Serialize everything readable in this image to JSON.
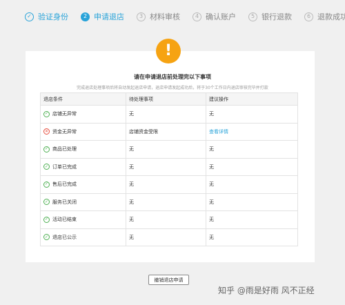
{
  "steps": [
    {
      "num": "✓",
      "label": "验证身份",
      "state": "done"
    },
    {
      "num": "2",
      "label": "申请退店",
      "state": "active"
    },
    {
      "num": "3",
      "label": "材料审核",
      "state": "todo"
    },
    {
      "num": "4",
      "label": "确认账户",
      "state": "todo"
    },
    {
      "num": "5",
      "label": "银行退款",
      "state": "todo"
    },
    {
      "num": "6",
      "label": "退款成功",
      "state": "todo"
    }
  ],
  "notice": {
    "icon": "!",
    "title": "请在申请退店前处理完以下事项",
    "subtitle": "完成退店处理事项后将自动发起退店申请，退店申请发起成功后，将于30个工作日内退店审核完毕并打款"
  },
  "table": {
    "headers": [
      "退店条件",
      "待处理事项",
      "建议操作"
    ],
    "rows": [
      {
        "status": "ok",
        "condition": "店铺无异常",
        "pending": "无",
        "action": "无"
      },
      {
        "status": "bad",
        "condition": "资金无异常",
        "pending": "店铺资金受限",
        "action": "查看详情"
      },
      {
        "status": "ok",
        "condition": "商品已处理",
        "pending": "无",
        "action": "无"
      },
      {
        "status": "ok",
        "condition": "订单已完成",
        "pending": "无",
        "action": "无"
      },
      {
        "status": "ok",
        "condition": "售后已完成",
        "pending": "无",
        "action": "无"
      },
      {
        "status": "ok",
        "condition": "服务已关闭",
        "pending": "无",
        "action": "无"
      },
      {
        "status": "ok",
        "condition": "活动已结束",
        "pending": "无",
        "action": "无"
      },
      {
        "status": "ok",
        "condition": "退店已公示",
        "pending": "无",
        "action": "无"
      }
    ]
  },
  "cancel_button": "撤销退店申请",
  "watermark": "知乎 @雨是好雨 风不正经",
  "colors": {
    "accent": "#29a3d9",
    "warning": "#f6a312",
    "ok": "#4caf50",
    "error": "#e74c3c"
  }
}
